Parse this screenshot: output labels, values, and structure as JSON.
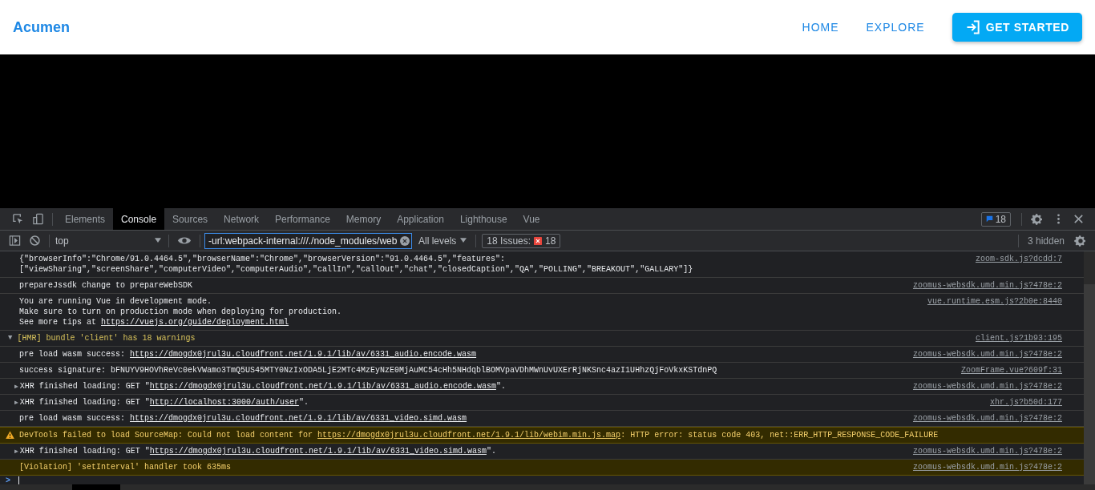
{
  "app": {
    "brand": "Acumen",
    "nav": [
      {
        "label": "HOME"
      },
      {
        "label": "EXPLORE"
      }
    ],
    "cta": "GET STARTED"
  },
  "devtools": {
    "tabs": [
      {
        "label": "Elements",
        "selected": false
      },
      {
        "label": "Console",
        "selected": true
      },
      {
        "label": "Sources",
        "selected": false
      },
      {
        "label": "Network",
        "selected": false
      },
      {
        "label": "Performance",
        "selected": false
      },
      {
        "label": "Memory",
        "selected": false
      },
      {
        "label": "Application",
        "selected": false
      },
      {
        "label": "Lighthouse",
        "selected": false
      },
      {
        "label": "Vue",
        "selected": false
      }
    ],
    "issues_badge": "18",
    "toolbar": {
      "context": "top",
      "filter_value": "-url:webpack-internal:///./node_modules/web",
      "levels": "All levels",
      "issues_label": "18 Issues:",
      "issues_count": "18",
      "hidden": "3 hidden"
    },
    "messages": [
      {
        "kind": "log",
        "lines": [
          [
            {
              "text": "{\"browserInfo\":\"Chrome/91.0.4464.5\",\"browserName\":\"Chrome\",\"browserVersion\":\"91.0.4464.5\",\"features\":",
              "link": false
            }
          ],
          [
            {
              "text": "[\"viewSharing\",\"screenShare\",\"computerVideo\",\"computerAudio\",\"callIn\",\"callOut\",\"chat\",\"closedCaption\",\"QA\",\"POLLING\",\"BREAKOUT\",\"GALLARY\"]}",
              "link": false
            }
          ]
        ],
        "source": "zoom-sdk.js?dcdd:7"
      },
      {
        "kind": "log",
        "lines": [
          [
            {
              "text": "prepareJssdk change to prepareWebSDK",
              "link": false
            }
          ]
        ],
        "source": "zoomus-websdk.umd.min.js?478e:2"
      },
      {
        "kind": "log",
        "lines": [
          [
            {
              "text": "You are running Vue in development mode.",
              "link": false
            }
          ],
          [
            {
              "text": "Make sure to turn on production mode when deploying for production.",
              "link": false
            }
          ],
          [
            {
              "text": "See more tips at ",
              "link": false
            },
            {
              "text": "https://vuejs.org/guide/deployment.html",
              "link": true
            }
          ]
        ],
        "source": "vue.runtime.esm.js?2b0e:8440"
      },
      {
        "kind": "group",
        "toggle": "▼",
        "lines": [
          [
            {
              "text": "[HMR] bundle 'client' has 18 warnings",
              "link": false
            }
          ]
        ],
        "source": "client.js?1b93:195"
      },
      {
        "kind": "log",
        "lines": [
          [
            {
              "text": "pre load wasm success: ",
              "link": false
            },
            {
              "text": "https://dmogdx0jrul3u.cloudfront.net/1.9.1/lib/av/6331_audio.encode.wasm",
              "link": true
            }
          ]
        ],
        "source": "zoomus-websdk.umd.min.js?478e:2"
      },
      {
        "kind": "log",
        "lines": [
          [
            {
              "text": "success signature: bFNUYV9HOVhReVc0ekVWamo3TmQ5US45MTY0NzIxODA5LjE2MTc4MzEyNzE0MjAuMC54cHh5NHdqblBOMVpaVDhMWnUvUXErRjNKSnc4azI1UHhzQjFoVkxKSTdnPQ",
              "link": false
            }
          ]
        ],
        "source": "ZoomFrame.vue?609f:31"
      },
      {
        "kind": "log",
        "toggle": "▶",
        "lines": [
          [
            {
              "text": "XHR finished loading: GET \"",
              "link": false
            },
            {
              "text": "https://dmogdx0jrul3u.cloudfront.net/1.9.1/lib/av/6331_audio.encode.wasm",
              "link": true
            },
            {
              "text": "\".",
              "link": false
            }
          ]
        ],
        "source": "zoomus-websdk.umd.min.js?478e:2"
      },
      {
        "kind": "log",
        "toggle": "▶",
        "lines": [
          [
            {
              "text": "XHR finished loading: GET \"",
              "link": false
            },
            {
              "text": "http://localhost:3000/auth/user",
              "link": true
            },
            {
              "text": "\".",
              "link": false
            }
          ]
        ],
        "source": "xhr.js?b50d:177"
      },
      {
        "kind": "log",
        "lines": [
          [
            {
              "text": "pre load wasm success: ",
              "link": false
            },
            {
              "text": "https://dmogdx0jrul3u.cloudfront.net/1.9.1/lib/av/6331_video.simd.wasm",
              "link": true
            }
          ]
        ],
        "source": "zoomus-websdk.umd.min.js?478e:2"
      },
      {
        "kind": "warning",
        "lines": [
          [
            {
              "text": "DevTools failed to load SourceMap: Could not load content for ",
              "link": false
            },
            {
              "text": "https://dmogdx0jrul3u.cloudfront.net/1.9.1/lib/webim.min.js.map",
              "link": true
            },
            {
              "text": ": HTTP error: status code 403, net::ERR_HTTP_RESPONSE_CODE_FAILURE",
              "link": false
            }
          ]
        ]
      },
      {
        "kind": "log",
        "toggle": "▶",
        "lines": [
          [
            {
              "text": "XHR finished loading: GET \"",
              "link": false
            },
            {
              "text": "https://dmogdx0jrul3u.cloudfront.net/1.9.1/lib/av/6331_video.simd.wasm",
              "link": true
            },
            {
              "text": "\".",
              "link": false
            }
          ]
        ],
        "source": "zoomus-websdk.umd.min.js?478e:2"
      },
      {
        "kind": "violation",
        "lines": [
          [
            {
              "text": "[Violation] 'setInterval' handler took 635ms",
              "link": false
            }
          ]
        ],
        "source": "zoomus-websdk.umd.min.js?478e:2"
      }
    ],
    "prompt": ">"
  }
}
